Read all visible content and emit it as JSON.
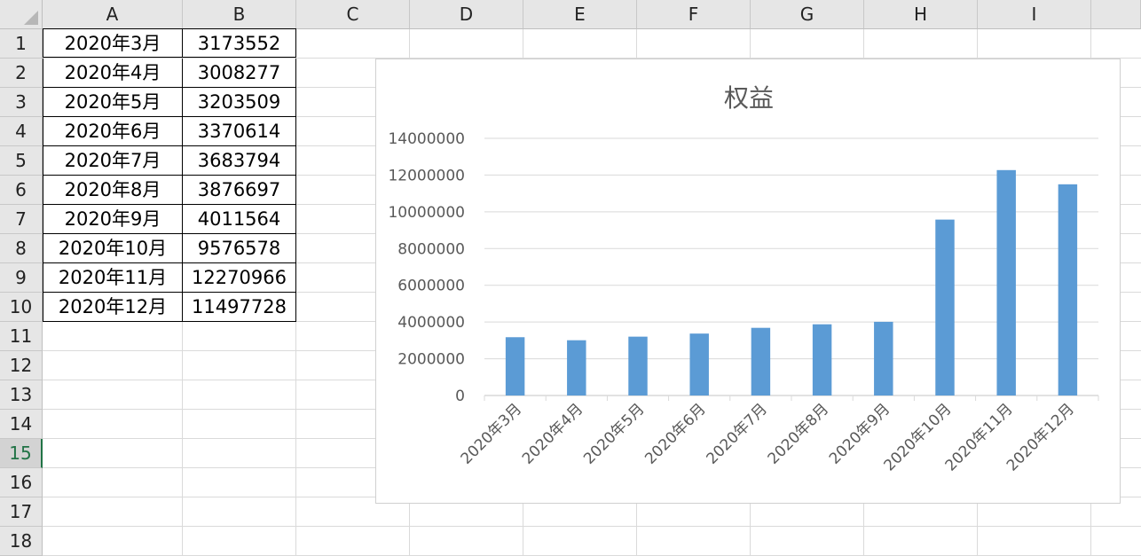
{
  "columns": [
    "A",
    "B",
    "C",
    "D",
    "E",
    "F",
    "G",
    "H",
    "I"
  ],
  "rows": [
    "1",
    "2",
    "3",
    "4",
    "5",
    "6",
    "7",
    "8",
    "9",
    "10",
    "11",
    "12",
    "13",
    "14",
    "15",
    "16",
    "17",
    "18"
  ],
  "active_row": "15",
  "cells": [
    {
      "a": "2020年3月",
      "b": "3173552"
    },
    {
      "a": "2020年4月",
      "b": "3008277"
    },
    {
      "a": "2020年5月",
      "b": "3203509"
    },
    {
      "a": "2020年6月",
      "b": "3370614"
    },
    {
      "a": "2020年7月",
      "b": "3683794"
    },
    {
      "a": "2020年8月",
      "b": "3876697"
    },
    {
      "a": "2020年9月",
      "b": "4011564"
    },
    {
      "a": "2020年10月",
      "b": "9576578"
    },
    {
      "a": "2020年11月",
      "b": "12270966"
    },
    {
      "a": "2020年12月",
      "b": "11497728"
    }
  ],
  "chart_data": {
    "type": "bar",
    "title": "权益",
    "categories": [
      "2020年3月",
      "2020年4月",
      "2020年5月",
      "2020年6月",
      "2020年7月",
      "2020年8月",
      "2020年9月",
      "2020年10月",
      "2020年11月",
      "2020年12月"
    ],
    "values": [
      3173552,
      3008277,
      3203509,
      3370614,
      3683794,
      3876697,
      4011564,
      9576578,
      12270966,
      11497728
    ],
    "yticks": [
      "0",
      "2000000",
      "4000000",
      "6000000",
      "8000000",
      "10000000",
      "12000000",
      "14000000"
    ],
    "ylim": [
      0,
      14000000
    ],
    "grid": true,
    "legend": "none",
    "bar_color": "#5b9bd5",
    "grid_color": "#d9d9d9",
    "axis_text_color": "#595959"
  }
}
